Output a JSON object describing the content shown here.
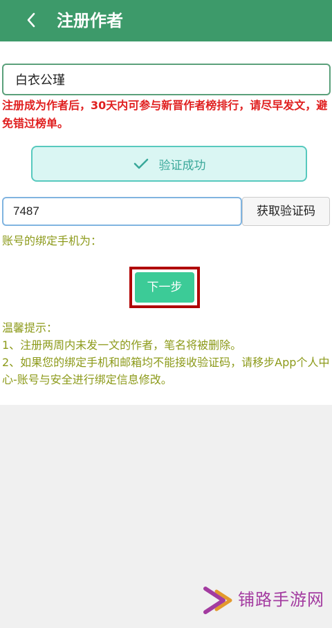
{
  "header": {
    "title": "注册作者"
  },
  "form": {
    "author_name": "白衣公瑾",
    "warning": "注册成为作者后，30天内可参与新晋作者榜排行，请尽早发文，避免错过榜单。",
    "verified_label": "验证成功",
    "code_value": "7487",
    "get_code_label": "获取验证码",
    "phone_label": "账号的绑定手机为：",
    "next_label": "下一步"
  },
  "tips": {
    "title": "温馨提示：",
    "item1": "1、注册两周内未发一文的作者，笔名将被删除。",
    "item2": "2、如果您的绑定手机和邮箱均不能接收验证码，请移步App个人中心-账号与安全进行绑定信息修改。"
  },
  "watermark": {
    "text": "铺路手游网",
    "icon": "arrow-chevron-logo"
  },
  "colors": {
    "header_bg": "#3d9a6a",
    "warning": "#e02020",
    "tip_text": "#8c9a1a",
    "next_button": "#3ccb97",
    "highlight": "#b00000",
    "verified_bg": "#daf6f3",
    "watermark": "#a33ba0"
  }
}
